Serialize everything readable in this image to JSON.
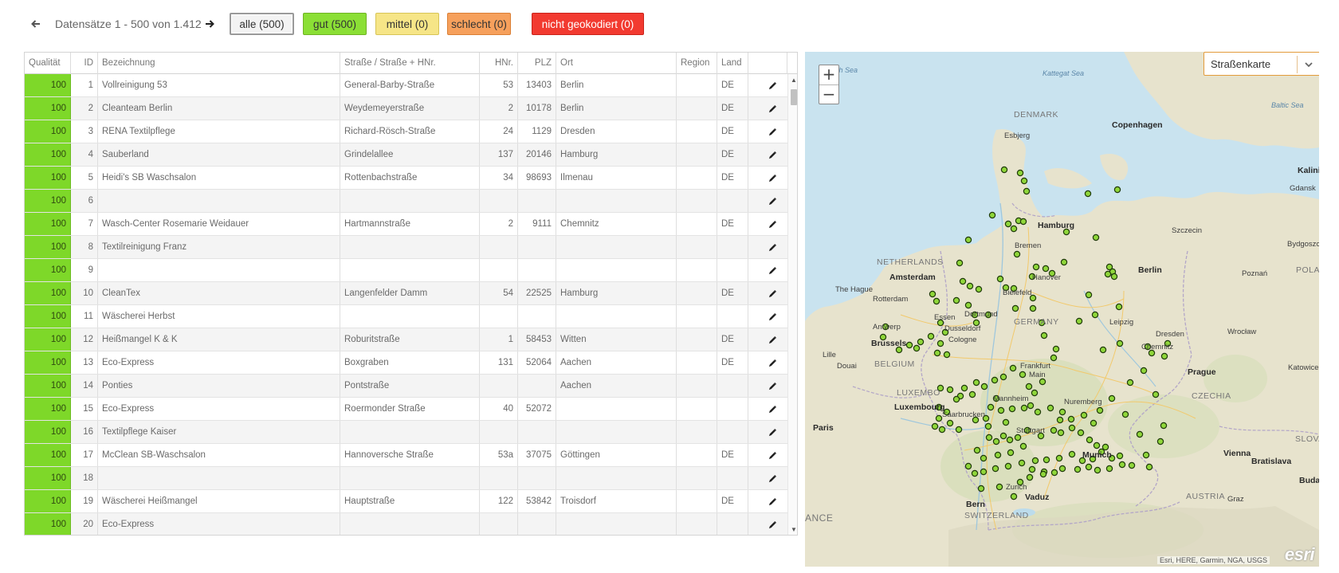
{
  "toolbar": {
    "range_text": "Datensätze 1 - 500 von 1.412",
    "filters": {
      "alle": "alle (500)",
      "gut": "gut (500)",
      "mittel": "mittel (0)",
      "schlecht": "schlecht (0)",
      "nicht": "nicht geokodiert (0)"
    }
  },
  "table": {
    "headers": [
      "Qualität",
      "ID",
      "Bezeichnung",
      "Straße / Straße + HNr.",
      "HNr.",
      "PLZ",
      "Ort",
      "Region",
      "Land"
    ],
    "rows": [
      [
        "100",
        "1",
        "Vollreinigung 53",
        "General-Barby-Straße",
        "53",
        "13403",
        "Berlin",
        "",
        "DE"
      ],
      [
        "100",
        "2",
        "Cleanteam Berlin",
        "Weydemeyerstraße",
        "2",
        "10178",
        "Berlin",
        "",
        "DE"
      ],
      [
        "100",
        "3",
        "RENA Textilpflege",
        "Richard-Rösch-Straße",
        "24",
        "1129",
        "Dresden",
        "",
        "DE"
      ],
      [
        "100",
        "4",
        "Sauberland",
        "Grindelallee",
        "137",
        "20146",
        "Hamburg",
        "",
        "DE"
      ],
      [
        "100",
        "5",
        "Heidi's SB Waschsalon",
        "Rottenbachstraße",
        "34",
        "98693",
        "Ilmenau",
        "",
        "DE"
      ],
      [
        "100",
        "6",
        "",
        "",
        "",
        "",
        "",
        "",
        ""
      ],
      [
        "100",
        "7",
        "Wasch-Center Rosemarie Weidauer",
        "Hartmannstraße",
        "2",
        "9111",
        "Chemnitz",
        "",
        "DE"
      ],
      [
        "100",
        "8",
        "Textilreinigung Franz",
        "",
        "",
        "",
        "",
        "",
        ""
      ],
      [
        "100",
        "9",
        "",
        "",
        "",
        "",
        "",
        "",
        ""
      ],
      [
        "100",
        "10",
        "CleanTex",
        "Langenfelder Damm",
        "54",
        "22525",
        "Hamburg",
        "",
        "DE"
      ],
      [
        "100",
        "11",
        "Wäscherei Herbst",
        "",
        "",
        "",
        "",
        "",
        ""
      ],
      [
        "100",
        "12",
        "Heißmangel K & K",
        "Roburitstraße",
        "1",
        "58453",
        "Witten",
        "",
        "DE"
      ],
      [
        "100",
        "13",
        "Eco-Express",
        "Boxgraben",
        "131",
        "52064",
        "Aachen",
        "",
        "DE"
      ],
      [
        "100",
        "14",
        "Ponties",
        "Pontstraße",
        "",
        "",
        "Aachen",
        "",
        ""
      ],
      [
        "100",
        "15",
        "Eco-Express",
        "Roermonder Straße",
        "40",
        "52072",
        "",
        "",
        ""
      ],
      [
        "100",
        "16",
        "Textilpflege Kaiser",
        "",
        "",
        "",
        "",
        "",
        ""
      ],
      [
        "100",
        "17",
        "McClean SB-Waschsalon",
        "Hannoversche Straße",
        "53a",
        "37075",
        "Göttingen",
        "",
        "DE"
      ],
      [
        "100",
        "18",
        "",
        "",
        "",
        "",
        "",
        "",
        ""
      ],
      [
        "100",
        "19",
        "Wäscherei Heißmangel",
        "Hauptstraße",
        "122",
        "53842",
        "Troisdorf",
        "",
        "DE"
      ],
      [
        "100",
        "20",
        "Eco-Express",
        "",
        "",
        "",
        "",
        "",
        ""
      ]
    ]
  },
  "map": {
    "basemap_selected": "Straßenkarte",
    "zoom_in": "+",
    "zoom_out": "−",
    "attribution": "Esri, HERE, Garmin, NGA, USGS",
    "logo": "esri",
    "labels": {
      "north_sea": "th Sea",
      "kattegat": "Kattegat Sea",
      "baltic": "Baltic Sea",
      "denmark": "DENMARK",
      "copenhagen": "Copenhagen",
      "esbjerg": "Esbjerg",
      "kalini": "Kalini",
      "gdansk": "Gdansk",
      "szczecin": "Szczecin",
      "bydgoszcz": "Bydgoszcz",
      "hamburg": "Hamburg",
      "bremen": "Bremen",
      "netherlands": "NETHERLANDS",
      "amsterdam": "Amsterdam",
      "hague": "The Hague",
      "rotterdam": "Rotterdam",
      "hanover": "Hanover",
      "berlin": "Berlin",
      "poznan": "Poznań",
      "poland": "POLANI",
      "bielefeld": "Bielefeld",
      "essen": "Essen",
      "dortmund": "Dortmund",
      "germany": "GERMANY",
      "antwerp": "Antwerp",
      "dusseldorf": "Dusseldorf",
      "leipzig": "Leipzig",
      "dresden": "Dresden",
      "wroclaw": "Wrocław",
      "brussels": "Brussels",
      "cologne": "Cologne",
      "chemnitz": "Chemnitz",
      "lille": "Lille",
      "douai": "Douai",
      "belgium": "BELGIUM",
      "frankfurt": "Frankfurt",
      "main": "Main",
      "katowice": "Katowice",
      "prague": "Prague",
      "luxembourg_c": "LUXEMBO",
      "luxembourg": "Luxembourg",
      "mannheim": "Mannheim",
      "nuremberg": "Nuremberg",
      "czechia": "CZECHIA",
      "saarbrucken": "Saarbrucken",
      "paris": "Paris",
      "stuttgart": "Stuttgart",
      "slova": "SLOVA",
      "munich": "Munich",
      "vienna": "Vienna",
      "bratislava": "Bratislava",
      "zurich": "Zurich",
      "austria": "AUSTRIA",
      "buda": "Buda",
      "bern": "Bern",
      "vaduz": "Vaduz",
      "graz": "Graz",
      "france": "ANCE",
      "switzerland": "SWITZERLAND"
    }
  }
}
